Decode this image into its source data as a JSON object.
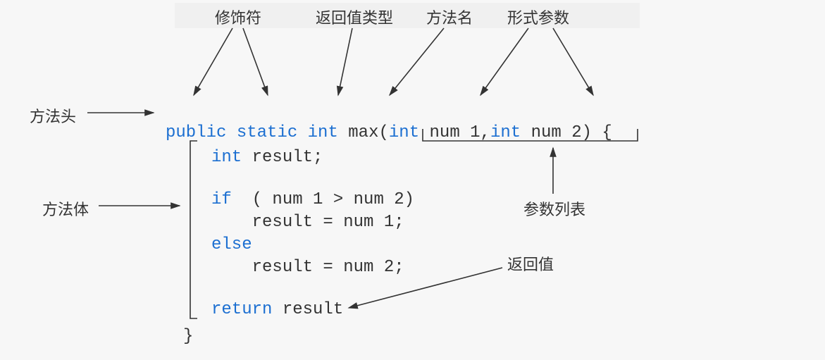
{
  "labels": {
    "method_header": "方法头",
    "method_body": "方法体",
    "modifier": "修饰符",
    "return_type": "返回值类型",
    "method_name": "方法名",
    "formal_params": "形式参数",
    "param_list": "参数列表",
    "return_value": "返回值"
  },
  "code": {
    "header": {
      "public": "public",
      "static": "static",
      "int": "int",
      "max": "max",
      "lparen": "(",
      "p1_type": "int",
      "p1_name": "num 1",
      "comma": ",",
      "p2_type": "int",
      "p2_name": "num 2",
      "rparen_brace": ") {"
    },
    "body": {
      "declare_type": "int",
      "declare_rest": " result;",
      "if_kw": "if",
      "if_cond": "  ( num 1 > num 2)",
      "if_stmt": "    result = num 1;",
      "else_kw": "else",
      "else_stmt": "    result = num 2;",
      "return_kw": "return",
      "return_expr": " result",
      "close": "}"
    }
  }
}
